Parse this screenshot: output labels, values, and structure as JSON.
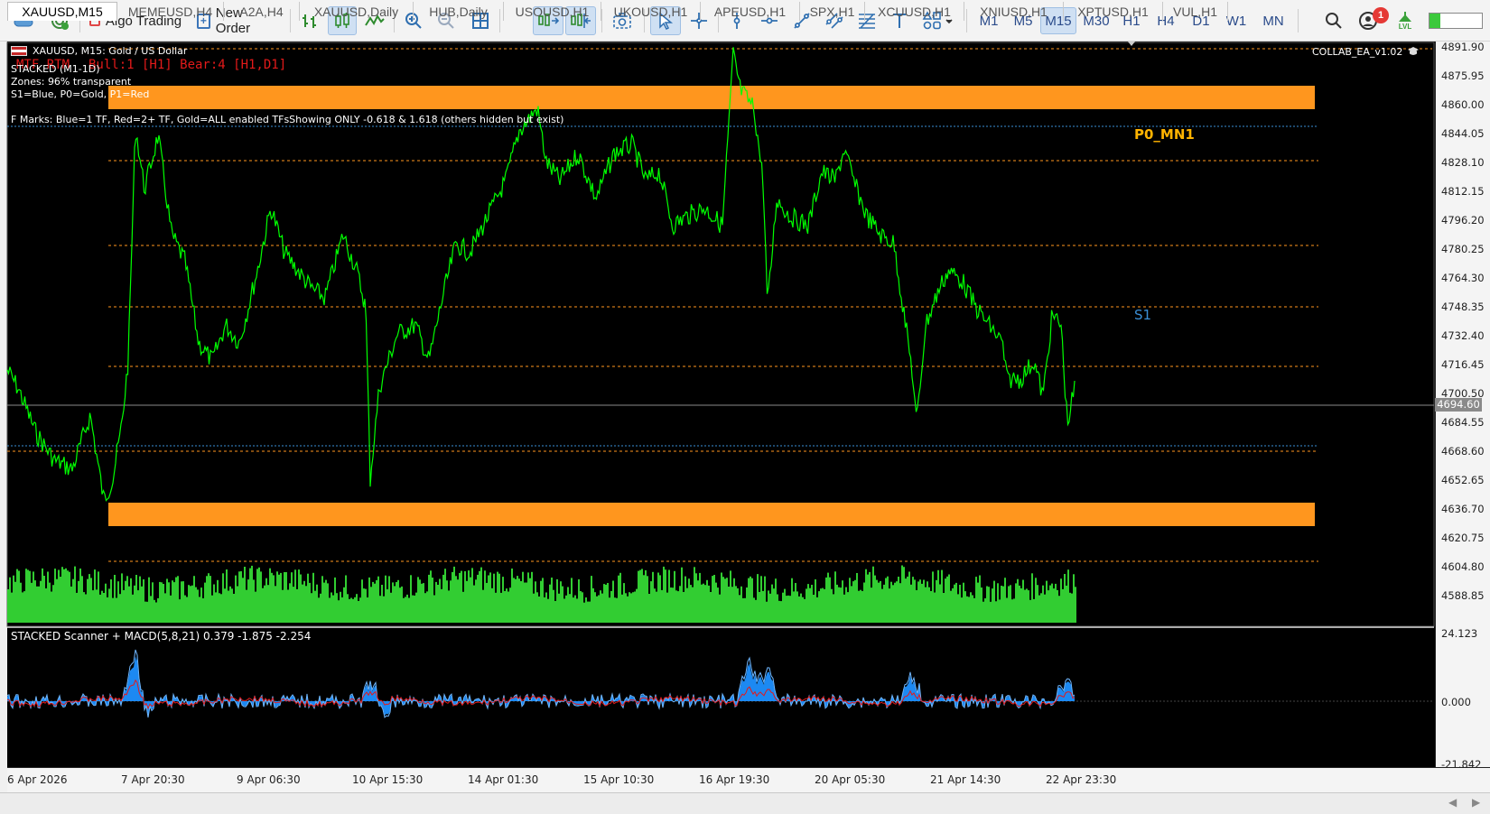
{
  "toolbar": {
    "algo_trading_label": "Algo Trading",
    "new_order_label": "New Order",
    "timeframes": [
      "M1",
      "M5",
      "M15",
      "M30",
      "H1",
      "H4",
      "D1",
      "W1",
      "MN"
    ],
    "active_timeframe": "M15",
    "notification_count": "1",
    "lvl_label": "LVL"
  },
  "chart": {
    "symbol_title": "XAUUSD, M15:  Gold / US Dollar",
    "mtf_line_a": "MTF RTM",
    "mtf_line_b": "Bull:1 [H1]  Bear:4 [H1,D1]",
    "stacked_line": "STACKED (M1-1D)",
    "zones_line": "Zones: 96% transparent",
    "legend_line": "S1=Blue, P0=Gold, P1=Red",
    "fmarks_line": "F Marks: Blue=1 TF, Red=2+ TF, Gold=ALL enabled TFsShowing ONLY -0.618 & 1.618 (others hidden but exist)",
    "ea_label": "COLLAB_EA_v1.02",
    "p0_label": "P0_MN1",
    "s1_label": "S1",
    "current_price": "4694.60",
    "price_labels": [
      "4891.90",
      "4875.95",
      "4860.00",
      "4844.05",
      "4828.10",
      "4812.15",
      "4796.20",
      "4780.25",
      "4764.30",
      "4748.35",
      "4732.40",
      "4716.45",
      "4700.50",
      "4684.55",
      "4668.60",
      "4652.65",
      "4636.70",
      "4620.75",
      "4604.80",
      "4588.85"
    ],
    "time_labels": [
      "6 Apr 2026",
      "7 Apr 20:30",
      "9 Apr 06:30",
      "10 Apr 15:30",
      "14 Apr 01:30",
      "15 Apr 10:30",
      "16 Apr 19:30",
      "20 Apr 05:30",
      "21 Apr 14:30",
      "22 Apr 23:30"
    ],
    "colors": {
      "price_line": "#00ff00",
      "zone": "#ff961e",
      "volume": "#32cd32",
      "macd": "#1e90ff",
      "signal": "#e31a1a"
    }
  },
  "indicator": {
    "title": "STACKED Scanner + MACD(5,8,21) 0.379 -1.875 -2.254",
    "scale_labels": [
      "24.123",
      "0.000",
      "-21.842"
    ]
  },
  "tabs": [
    "XAUUSD,M15",
    "MEMEUSD,H4",
    "A2A,H4",
    "XAUUSD,Daily",
    "HUB,Daily",
    "USOUSD,H1",
    "UKOUSD,H1",
    "APEUSD,H1",
    "SPX,H1",
    "XCUUSD,H1",
    "XNIUSD,H1",
    "XPTUSD,H1",
    "VUL,H1"
  ],
  "active_tab": "XAUUSD,M15"
}
